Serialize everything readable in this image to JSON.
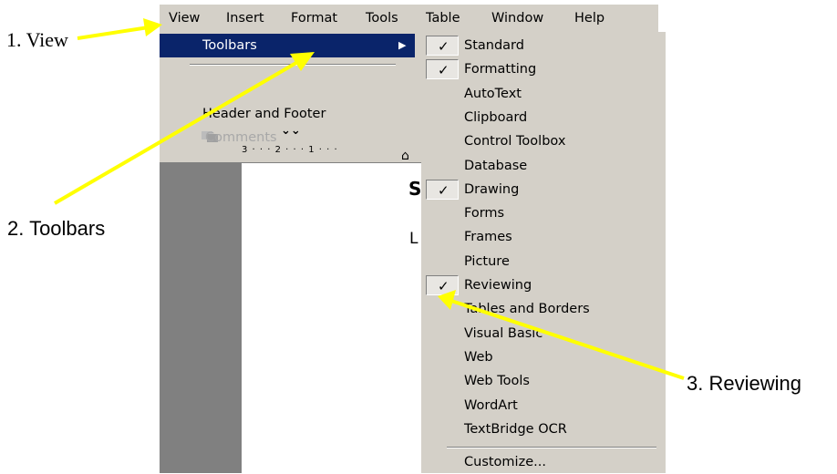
{
  "menubar": {
    "items": [
      "View",
      "Insert",
      "Format",
      "Tools",
      "Table",
      "Window",
      "Help"
    ]
  },
  "view_menu": {
    "toolbars_label": "Toolbars",
    "header_footer_label": "Header and Footer",
    "comments_label": "Comments",
    "expand_icon": "double-chevron-down-icon"
  },
  "toolbars_submenu": {
    "items": [
      {
        "label": "Standard",
        "checked": true
      },
      {
        "label": "Formatting",
        "checked": true
      },
      {
        "label": "AutoText",
        "checked": false
      },
      {
        "label": "Clipboard",
        "checked": false
      },
      {
        "label": "Control Toolbox",
        "checked": false
      },
      {
        "label": "Database",
        "checked": false
      },
      {
        "label": "Drawing",
        "checked": true
      },
      {
        "label": "Forms",
        "checked": false
      },
      {
        "label": "Frames",
        "checked": false
      },
      {
        "label": "Picture",
        "checked": false
      },
      {
        "label": "Reviewing",
        "checked": true
      },
      {
        "label": "Tables and Borders",
        "checked": false
      },
      {
        "label": "Visual Basic",
        "checked": false
      },
      {
        "label": "Web",
        "checked": false
      },
      {
        "label": "Web Tools",
        "checked": false
      },
      {
        "label": "WordArt",
        "checked": false
      },
      {
        "label": "TextBridge OCR",
        "checked": false
      }
    ],
    "customize_label": "Customize..."
  },
  "document": {
    "ruler_marks": "3 · · · 2 · · · 1 · · ·",
    "visible_letter_1": "S",
    "visible_letter_2": "L"
  },
  "callouts": {
    "view": "1. View",
    "toolbars": "2. Toolbars",
    "reviewing": "3. Reviewing"
  },
  "colors": {
    "menu_bg": "#d4d0c8",
    "highlight": "#0a246a",
    "arrow": "#ffff00",
    "disabled_text": "#a8a8a8"
  }
}
